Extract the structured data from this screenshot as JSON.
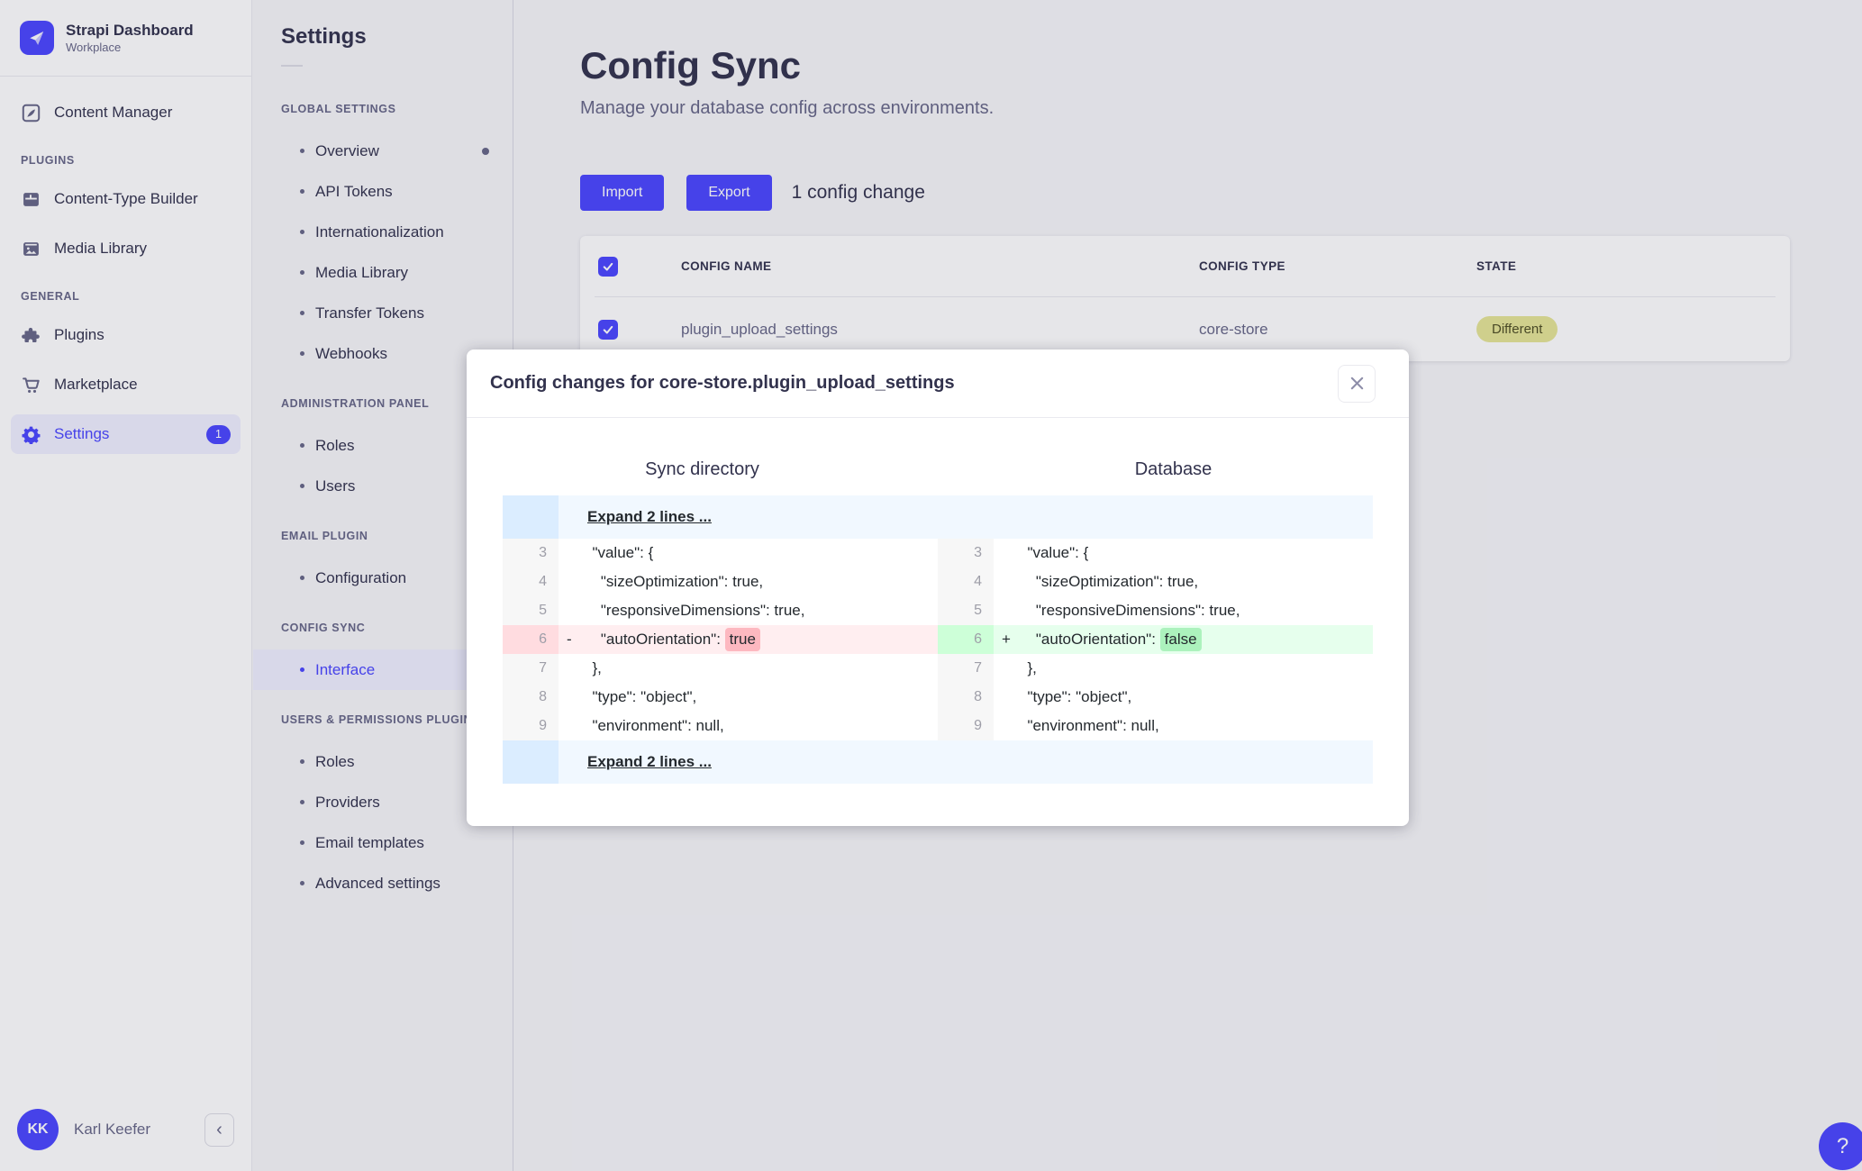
{
  "brand": {
    "title": "Strapi Dashboard",
    "subtitle": "Workplace"
  },
  "nav": {
    "content_manager": "Content Manager",
    "sections": [
      {
        "label": "PLUGINS",
        "items": [
          "Content-Type Builder",
          "Media Library"
        ]
      },
      {
        "label": "GENERAL",
        "items": [
          "Plugins",
          "Marketplace",
          "Settings"
        ]
      }
    ],
    "settings_badge": "1",
    "collapse_icon": "‹",
    "user": {
      "initials": "KK",
      "name": "Karl Keefer"
    }
  },
  "subnav": {
    "title": "Settings",
    "sections": [
      {
        "label": "GLOBAL SETTINGS",
        "items": [
          "Overview",
          "API Tokens",
          "Internationalization",
          "Media Library",
          "Transfer Tokens",
          "Webhooks"
        ]
      },
      {
        "label": "ADMINISTRATION PANEL",
        "items": [
          "Roles",
          "Users"
        ]
      },
      {
        "label": "EMAIL PLUGIN",
        "items": [
          "Configuration"
        ]
      },
      {
        "label": "CONFIG SYNC",
        "items": [
          "Interface"
        ]
      },
      {
        "label": "USERS & PERMISSIONS PLUGIN",
        "items": [
          "Roles",
          "Providers",
          "Email templates",
          "Advanced settings"
        ]
      }
    ]
  },
  "main": {
    "title": "Config Sync",
    "subtitle": "Manage your database config across environments.",
    "import_label": "Import",
    "export_label": "Export",
    "changes_label": "1 config change",
    "table": {
      "headers": [
        "CONFIG NAME",
        "CONFIG TYPE",
        "STATE"
      ],
      "rows": [
        {
          "name": "plugin_upload_settings",
          "type": "core-store",
          "state": "Different"
        }
      ]
    }
  },
  "modal": {
    "title": "Config changes for core-store.plugin_upload_settings",
    "left_header": "Sync directory",
    "right_header": "Database",
    "expand_top": "Expand 2 lines ...",
    "expand_bottom": "Expand 2 lines ...",
    "diff_lines": [
      {
        "num": "3",
        "text": "  \"value\": {"
      },
      {
        "num": "4",
        "text": "    \"sizeOptimization\": true,"
      },
      {
        "num": "5",
        "text": "    \"responsiveDimensions\": true,"
      },
      {
        "num": "6",
        "left_marker": "-",
        "right_marker": "+",
        "code_pre": "    \"autoOrientation\": ",
        "left_word": "true",
        "right_word": "false"
      },
      {
        "num": "7",
        "text": "  },"
      },
      {
        "num": "8",
        "text": "  \"type\": \"object\","
      },
      {
        "num": "9",
        "text": "  \"environment\": null,"
      }
    ]
  },
  "help_label": "?",
  "colors": {
    "accent": "#4945ff",
    "removed_word": "#fdb8c0",
    "added_word": "#acf2bd",
    "state_badge_bg": "#e5e596"
  }
}
